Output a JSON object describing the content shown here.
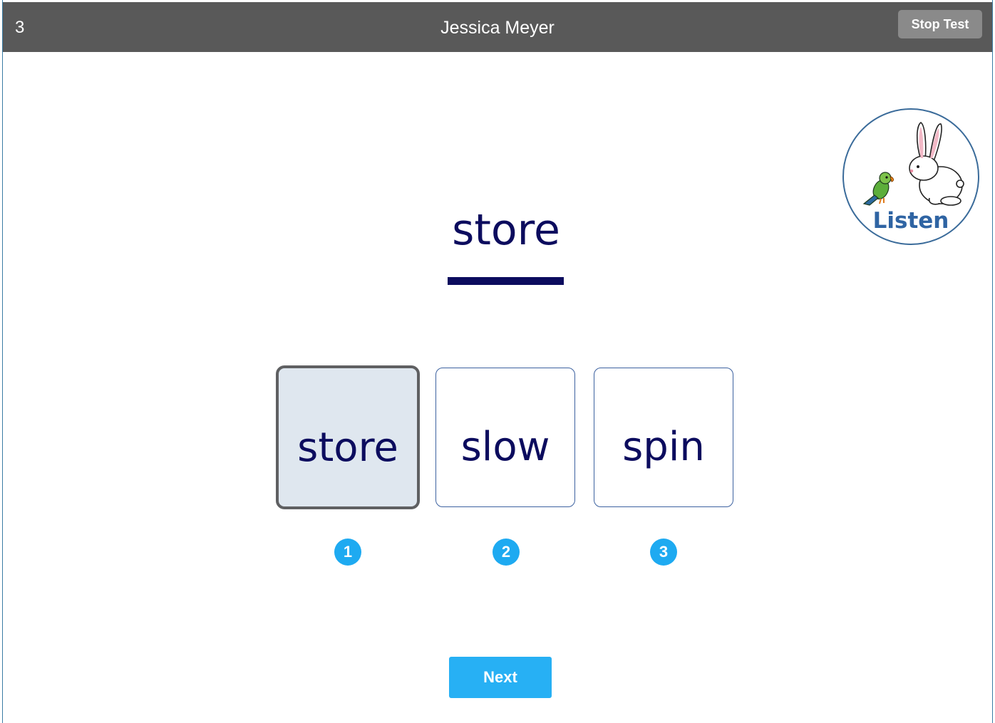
{
  "header": {
    "item_number": "3",
    "student_name": "Jessica Meyer",
    "stop_label": "Stop Test"
  },
  "listen": {
    "label": "Listen",
    "icon": "rabbit-parrot-icon"
  },
  "prompt": {
    "word": "store"
  },
  "choices": [
    {
      "word": "store",
      "number": "1",
      "selected": true
    },
    {
      "word": "slow",
      "number": "2",
      "selected": false
    },
    {
      "word": "spin",
      "number": "3",
      "selected": false
    }
  ],
  "footer": {
    "next_label": "Next"
  },
  "colors": {
    "header_bg": "#595959",
    "word_color": "#0c0c5e",
    "accent_blue": "#27b0f4",
    "selected_bg": "#dfe7ef"
  }
}
